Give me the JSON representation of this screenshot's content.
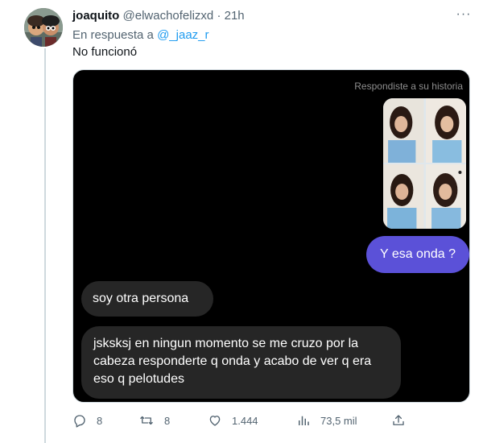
{
  "tweet": {
    "author_name": "joaquito",
    "author_handle": "@elwachofelizxd",
    "separator": "·",
    "timestamp": "21h",
    "more_label": "···",
    "reply_prefix": "En respuesta a",
    "reply_mention": "@_jaaz_r",
    "text": "No funcionó"
  },
  "screenshot": {
    "story_caption": "Respondiste a su historia",
    "sent_message": "Y esa onda ?",
    "received_messages": [
      "soy otra persona",
      "jsksksj en ningun momento se me cruzo por la cabeza responderte q onda y acabo de ver q era eso q pelotudes"
    ]
  },
  "actions": {
    "replies": "8",
    "retweets": "8",
    "likes": "1.444",
    "views": "73,5 mil"
  },
  "colors": {
    "accent_link": "#1d9bf0",
    "sent_bubble": "#5b51d8",
    "received_bubble": "#262626",
    "muted_text": "#536471"
  },
  "icons": {
    "reply": "reply-icon",
    "retweet": "retweet-icon",
    "like": "heart-icon",
    "views": "views-chart-icon",
    "share": "share-icon",
    "more": "more-icon"
  }
}
